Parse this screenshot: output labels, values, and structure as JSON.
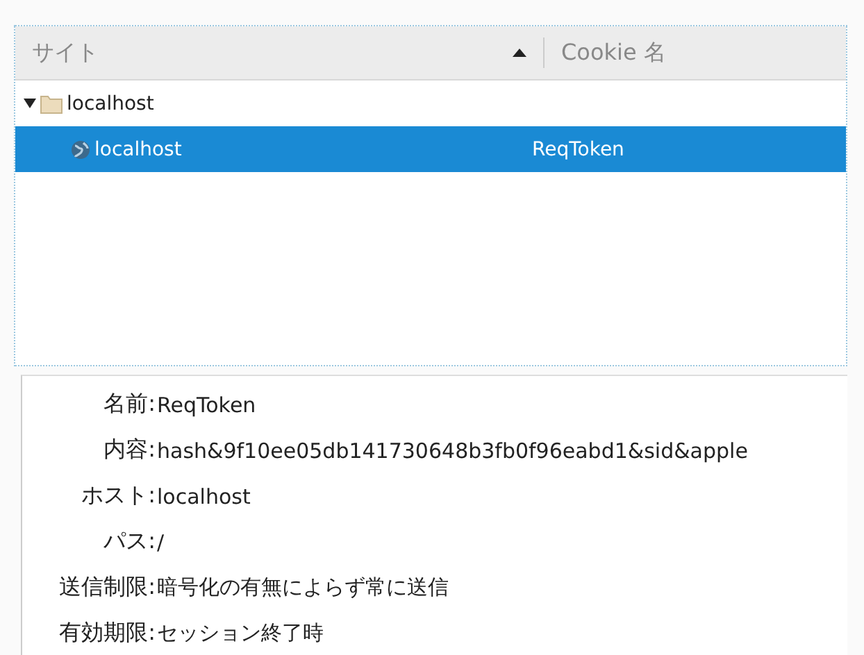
{
  "tree": {
    "columns": [
      {
        "label": "サイト",
        "sorted": true
      },
      {
        "label": "Cookie 名",
        "sorted": false
      }
    ],
    "rows": [
      {
        "kind": "folder",
        "site": "localhost",
        "expanded": true,
        "selected": false,
        "children": [
          {
            "kind": "site",
            "site": "localhost",
            "cookie": "ReqToken",
            "selected": true
          }
        ]
      }
    ]
  },
  "details": [
    {
      "label": "名前:",
      "value": "ReqToken"
    },
    {
      "label": "内容:",
      "value": "hash&9f10ee05db141730648b3fb0f96eabd1&sid&apple"
    },
    {
      "label": "ホスト:",
      "value": "localhost"
    },
    {
      "label": "パス:",
      "value": "/"
    },
    {
      "label": "送信制限:",
      "value": "暗号化の有無によらず常に送信"
    },
    {
      "label": "有効期限:",
      "value": "セッション終了時"
    }
  ]
}
